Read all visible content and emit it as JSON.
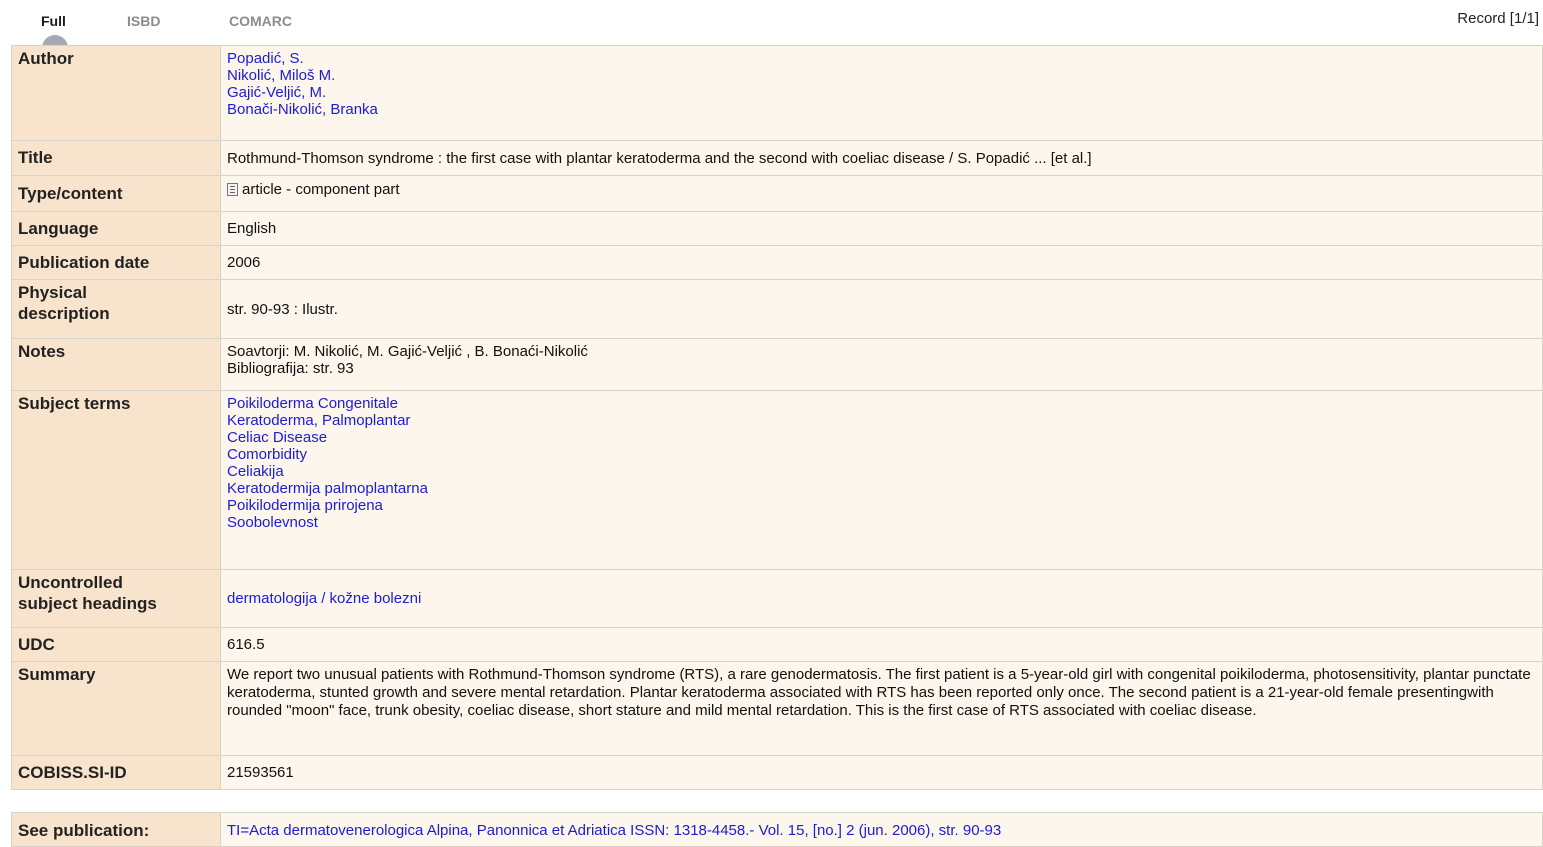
{
  "tabs": [
    {
      "label": "Full",
      "active": true
    },
    {
      "label": "ISBD",
      "active": false
    },
    {
      "label": "COMARC",
      "active": false
    }
  ],
  "record_counter": "Record [1/1]",
  "record": {
    "author": {
      "label": "Author",
      "values": [
        "Popadić, S.",
        "Nikolić, Miloš M.",
        "Gajić-Veljić, M.",
        "Bonači-Nikolić, Branka"
      ]
    },
    "title": {
      "label": "Title",
      "value": "Rothmund-Thomson syndrome : the first case with plantar keratoderma and the second with coeliac disease / S. Popadić ... [et al.]"
    },
    "type_content": {
      "label": "Type/content",
      "icon": "document-icon",
      "value": "article - component part"
    },
    "language": {
      "label": "Language",
      "value": "English"
    },
    "publication_date": {
      "label": "Publication date",
      "value": "2006"
    },
    "physical_description": {
      "label_line1": "Physical",
      "label_line2": "description",
      "value": "str. 90-93 : Ilustr."
    },
    "notes": {
      "label": "Notes",
      "values": [
        "Soavtorji: M. Nikolić, M. Gajić-Veljić , B. Bonaći-Nikolić",
        "Bibliografija: str. 93"
      ]
    },
    "subject_terms": {
      "label": "Subject terms",
      "values": [
        "Poikiloderma Congenitale",
        "Keratoderma, Palmoplantar",
        "Celiac Disease",
        "Comorbidity",
        "Celiakija",
        "Keratodermija palmoplantarna",
        "Poikilodermija prirojena",
        "Soobolevnost"
      ]
    },
    "uncontrolled": {
      "label_line1": "Uncontrolled",
      "label_line2": "subject headings",
      "value": "dermatologija / kožne bolezni"
    },
    "udc": {
      "label": "UDC",
      "value": "616.5"
    },
    "summary": {
      "label": "Summary",
      "value": "We report two unusual patients with Rothmund-Thomson syndrome (RTS), a rare genodermatosis. The first patient is a 5-year-old girl with congenital poikiloderma, photosensitivity, plantar punctate keratoderma, stunted growth and severe mental retardation. Plantar keratoderma associated with RTS has been reported only once. The second patient is a 21-year-old female presentingwith rounded \"moon\" face, trunk obesity, coeliac disease, short stature and mild mental retardation. This is the first case of RTS associated with coeliac disease."
    },
    "cobiss_id": {
      "label": "COBISS.SI-ID",
      "value": "21593561"
    }
  },
  "see_publication": {
    "label": "See publication:",
    "value": "TI=Acta dermatovenerologica Alpina, Panonnica et Adriatica ISSN: 1318-4458.- Vol. 15, [no.] 2 (jun. 2006), str. 90-93"
  },
  "colors": {
    "label_bg": "#f8e4cc",
    "value_bg": "#fcf6ec",
    "border": "#d9d3c7",
    "link": "#1c1cd6"
  }
}
